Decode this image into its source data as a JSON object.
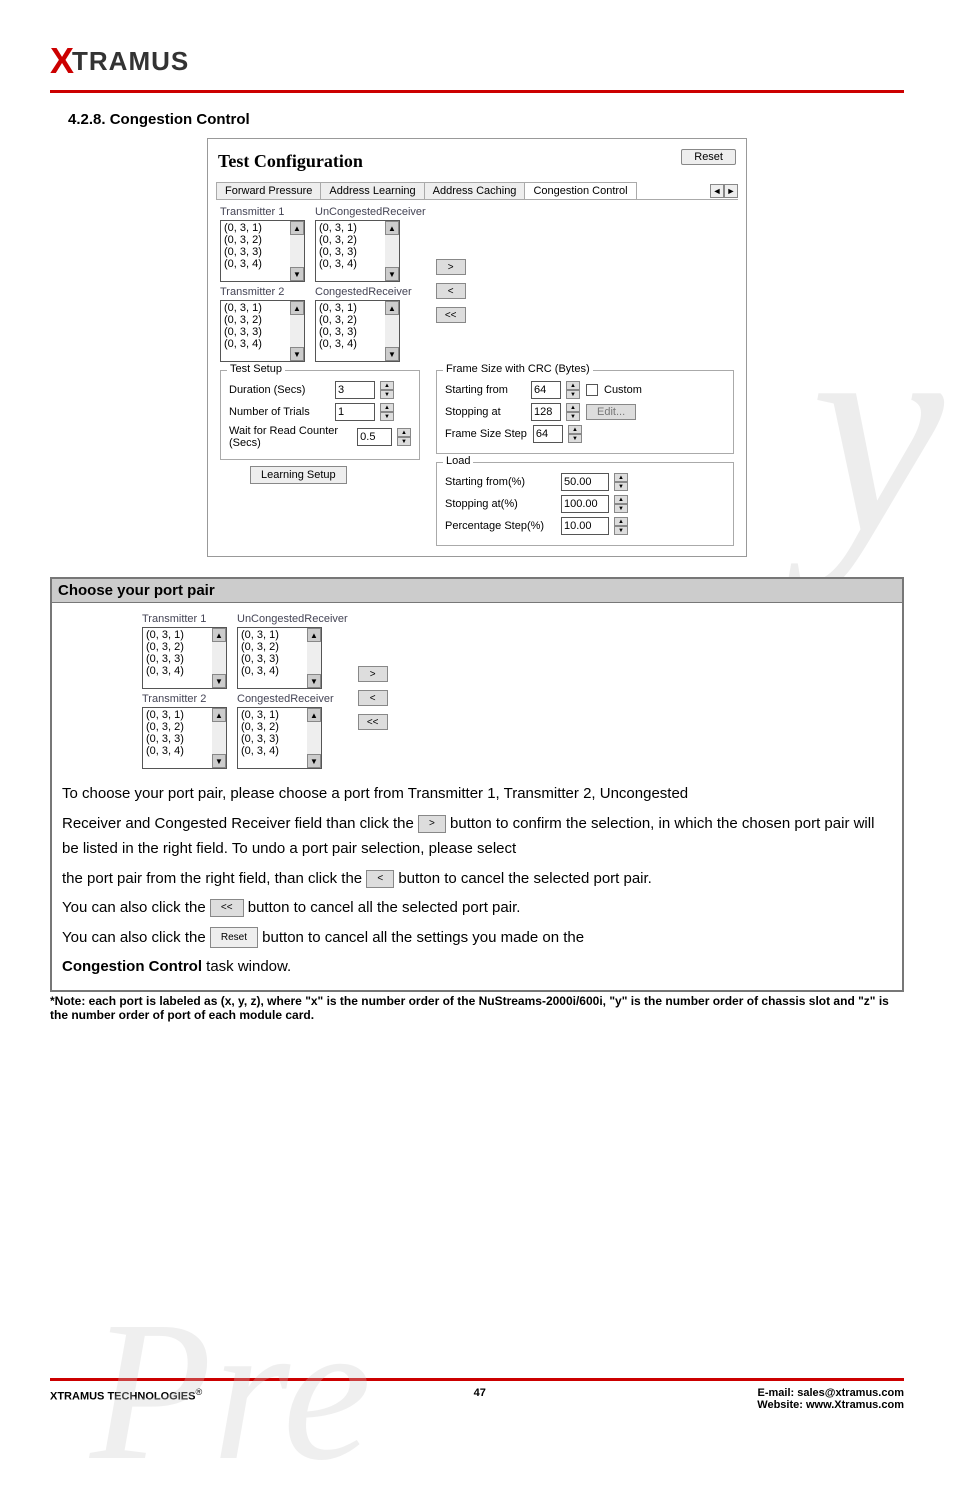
{
  "header": {
    "logo_x": "X",
    "logo_text": "TRAMUS"
  },
  "section": {
    "number_title": "4.2.8. Congestion Control"
  },
  "screenshot1": {
    "title": "Test Configuration",
    "reset": "Reset",
    "tabs": [
      "Forward Pressure",
      "Address Learning",
      "Address Caching",
      "Congestion Control"
    ],
    "scroll_left": "◄",
    "scroll_right": "►",
    "tx1_label": "Transmitter 1",
    "uncong_label": "UnCongestedReceiver",
    "tx2_label": "Transmitter 2",
    "cong_label": "CongestedReceiver",
    "ports": [
      "(0, 3, 1)",
      "(0, 3, 2)",
      "(0, 3, 3)",
      "(0, 3, 4)"
    ],
    "btn_add": ">",
    "btn_remove": "<",
    "btn_remove_all": "<<",
    "test_setup_legend": "Test Setup",
    "duration_label": "Duration (Secs)",
    "duration_val": "3",
    "trials_label": "Number of Trials",
    "trials_val": "1",
    "wait_label": "Wait for Read Counter (Secs)",
    "wait_val": "0.5",
    "learning_btn": "Learning Setup",
    "frame_legend": "Frame Size with CRC (Bytes)",
    "start_from": "Starting from",
    "start_val": "64",
    "custom_label": "Custom",
    "stop_at": "Stopping at",
    "stop_val": "128",
    "edit_btn": "Edit...",
    "step_label": "Frame Size Step",
    "step_val": "64",
    "load_legend": "Load",
    "load_start_label": "Starting from(%)",
    "load_start_val": "50.00",
    "load_stop_label": "Stopping at(%)",
    "load_stop_val": "100.00",
    "load_step_label": "Percentage Step(%)",
    "load_step_val": "10.00"
  },
  "grey_section": {
    "header": "Choose your port pair",
    "tx1_label": "Transmitter 1",
    "uncong_label": "UnCongestedReceiver",
    "tx2_label": "Transmitter 2",
    "cong_label": "CongestedReceiver",
    "ports": [
      "(0, 3, 1)",
      "(0, 3, 2)",
      "(0, 3, 3)",
      "(0, 3, 4)"
    ],
    "btn_add": ">",
    "btn_remove": "<",
    "btn_remove_all": "<<",
    "p1a": "To choose your port pair, please choose a port from Transmitter 1, Transmitter 2, Uncongested",
    "p1b_pre": "Receiver and Congested Receiver field than click the ",
    "p1b_post": " button to confirm the selection, in which the chosen port pair will be listed in the right field. To undo a port pair selection, please select",
    "p2_pre": "the port pair from the right field, than click the ",
    "p2_post": " button to cancel the selected port pair.",
    "p3_pre": "You can also click the ",
    "p3_post": " button to cancel all the selected port pair.",
    "p4_pre": "You can also click the ",
    "p4_post": " button to cancel all the settings you made on the ",
    "p4_name": "Congestion Control",
    "p4_suffix": " task window.",
    "reset_btn": "Reset"
  },
  "note": "*Note: each port is labeled as (x, y, z), where \"x\" is the number order of the NuStreams-2000i/600i, \"y\" is the number order of chassis slot and \"z\" is the number order of port of each module card.",
  "footer": {
    "left": "XTRAMUS TECHNOLOGIES",
    "reg": "®",
    "page": "47",
    "email_label": "E-mail: ",
    "email": "sales@xtramus.com",
    "web_label": "Website:  ",
    "web": "www.Xtramus.com"
  }
}
